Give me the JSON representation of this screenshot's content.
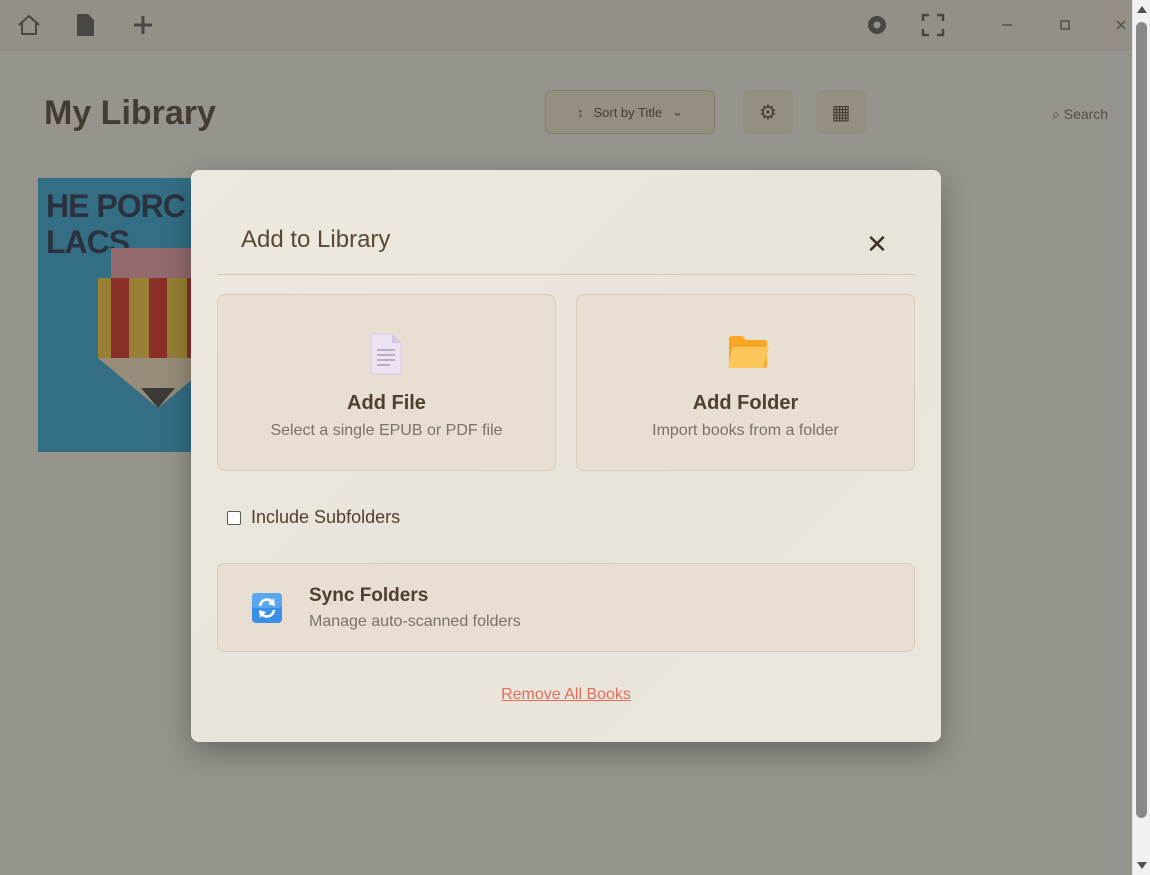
{
  "app": {
    "library_title": "My Library",
    "sort_label": "Sort by Title",
    "search_hint": "Search",
    "book": {
      "cover_title": "HE PORC\nLACS"
    }
  },
  "modal": {
    "title": "Add to Library",
    "close_label": "✕",
    "add_file": {
      "title": "Add File",
      "description": "Select a single EPUB or PDF file"
    },
    "add_folder": {
      "title": "Add Folder",
      "description": "Import books from a folder"
    },
    "include_subfolders": {
      "label": "Include Subfolders",
      "checked": false
    },
    "sync_folders": {
      "title": "Sync Folders",
      "description": "Manage auto-scanned folders"
    },
    "remove_all_label": "Remove All Books"
  },
  "colors": {
    "accent_text": "#5a4836",
    "danger": "#e06e5e",
    "card_bg": "#e6dfd2"
  }
}
